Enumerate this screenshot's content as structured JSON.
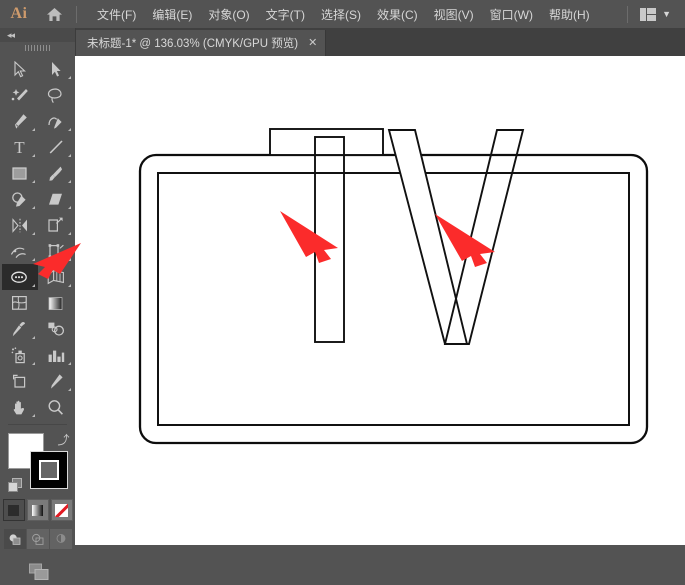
{
  "app": {
    "name": "Ai",
    "logo_color": "#cf9b6c",
    "chrome_bg": "#535353",
    "panel_bg": "#404040",
    "canvas_bg": "#ffffff"
  },
  "menubar": {
    "logo_label": "Ai",
    "home_icon": "home-icon",
    "items": [
      {
        "label": "文件(F)"
      },
      {
        "label": "编辑(E)"
      },
      {
        "label": "对象(O)"
      },
      {
        "label": "文字(T)"
      },
      {
        "label": "选择(S)"
      },
      {
        "label": "效果(C)"
      },
      {
        "label": "视图(V)"
      },
      {
        "label": "窗口(W)"
      },
      {
        "label": "帮助(H)"
      }
    ],
    "workspace_switcher": {
      "icon": "workspace-layout-icon",
      "chevron": "▼"
    }
  },
  "tabstrip": {
    "tab": {
      "title": "未标题-1* @ 136.03% (CMYK/GPU 预览)",
      "close_label": "✕",
      "document_name": "未标题-1*",
      "zoom": "136.03%",
      "color_mode": "CMYK",
      "render_mode": "GPU 预览",
      "modified": true
    }
  },
  "toolbar": {
    "collapse_label": "◂◂",
    "grip": "toolbar-grip",
    "selected_tool": "shape-builder-tool",
    "tools": [
      {
        "name": "selection-tool",
        "label": "选择工具",
        "has_flyout": false
      },
      {
        "name": "direct-selection-tool",
        "label": "直接选择工具",
        "has_flyout": true
      },
      {
        "name": "magic-wand-tool",
        "label": "魔棒工具",
        "has_flyout": false
      },
      {
        "name": "lasso-tool",
        "label": "套索工具",
        "has_flyout": false
      },
      {
        "name": "pen-tool",
        "label": "钢笔工具",
        "has_flyout": true
      },
      {
        "name": "curvature-tool",
        "label": "曲率工具",
        "has_flyout": false
      },
      {
        "name": "type-tool",
        "label": "文字工具",
        "has_flyout": true
      },
      {
        "name": "line-segment-tool",
        "label": "直线段工具",
        "has_flyout": true
      },
      {
        "name": "rectangle-tool",
        "label": "矩形工具",
        "has_flyout": true
      },
      {
        "name": "paintbrush-tool",
        "label": "画笔工具",
        "has_flyout": true
      },
      {
        "name": "shaper-tool",
        "label": "Shaper 工具",
        "has_flyout": true
      },
      {
        "name": "eraser-tool",
        "label": "橡皮擦工具",
        "has_flyout": true
      },
      {
        "name": "rotate-tool",
        "label": "旋转工具",
        "has_flyout": true
      },
      {
        "name": "scale-tool",
        "label": "比例缩放工具",
        "has_flyout": true
      },
      {
        "name": "width-tool",
        "label": "宽度工具",
        "has_flyout": true
      },
      {
        "name": "free-transform-tool",
        "label": "自由变换工具",
        "has_flyout": false
      },
      {
        "name": "shape-builder-tool",
        "label": "形状生成器工具",
        "has_flyout": true
      },
      {
        "name": "perspective-grid-tool",
        "label": "透视网格工具",
        "has_flyout": true
      },
      {
        "name": "mesh-tool",
        "label": "网格工具",
        "has_flyout": false
      },
      {
        "name": "gradient-tool",
        "label": "渐变工具",
        "has_flyout": false
      },
      {
        "name": "eyedropper-tool",
        "label": "吸管工具",
        "has_flyout": true
      },
      {
        "name": "blend-tool",
        "label": "混合工具",
        "has_flyout": false
      },
      {
        "name": "symbol-sprayer-tool",
        "label": "符号喷枪工具",
        "has_flyout": true
      },
      {
        "name": "column-graph-tool",
        "label": "柱形图工具",
        "has_flyout": true
      },
      {
        "name": "artboard-tool",
        "label": "画板工具",
        "has_flyout": false
      },
      {
        "name": "slice-tool",
        "label": "切片工具",
        "has_flyout": true
      },
      {
        "name": "hand-tool",
        "label": "抓手工具",
        "has_flyout": true
      },
      {
        "name": "zoom-tool",
        "label": "缩放工具",
        "has_flyout": false
      }
    ],
    "color_controls": {
      "fill_swatch": "#ffffff",
      "stroke_swatch": "#000000",
      "swap_icon": "swap-fill-stroke-icon",
      "default_icon": "default-fill-stroke-icon",
      "fill_label": "填色",
      "stroke_label": "描边"
    },
    "paint_modes": [
      {
        "name": "color-mode-button",
        "label": "颜色",
        "selected": true
      },
      {
        "name": "gradient-mode-button",
        "label": "渐变",
        "selected": false
      },
      {
        "name": "none-mode-button",
        "label": "无",
        "selected": false
      }
    ],
    "draw_modes": [
      {
        "name": "draw-normal-button",
        "label": "正常绘图",
        "selected": true
      },
      {
        "name": "draw-behind-button",
        "label": "背面绘图",
        "selected": false
      },
      {
        "name": "draw-inside-button",
        "label": "内部绘图",
        "selected": false
      }
    ],
    "screen_mode": {
      "name": "change-screen-mode-button",
      "label": "更改屏幕模式"
    }
  },
  "canvas": {
    "artboard": {
      "name": "tv-outline-artwork",
      "description": "TV 外框圆角矩形与内框矩形",
      "stroke_color": "#000000",
      "fill_color": "#ffffff"
    },
    "letters": [
      {
        "name": "letter-t",
        "text": "T",
        "construction": "两个重叠矩形"
      },
      {
        "name": "letter-v",
        "text": "V",
        "construction": "两个交叉平行四边形"
      }
    ],
    "annotations": [
      {
        "name": "annotation-arrow-t",
        "color": "#fb2b2b",
        "points_at": "letter-t-stem"
      },
      {
        "name": "annotation-arrow-v",
        "color": "#fb2b2b",
        "points_at": "letter-v-right-stroke"
      },
      {
        "name": "annotation-arrow-toolbar",
        "color": "#fb2b2b",
        "points_at": "shape-builder-tool"
      }
    ]
  }
}
